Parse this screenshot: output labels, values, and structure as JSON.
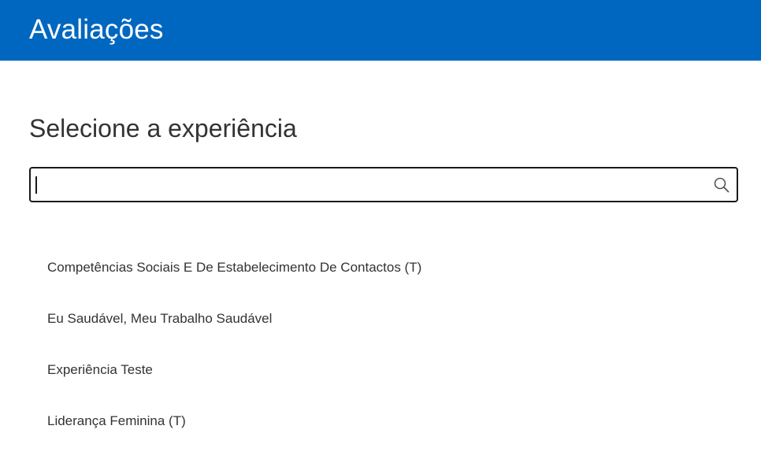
{
  "header": {
    "title": "Avaliações",
    "background_color": "#0067c0"
  },
  "main": {
    "heading": "Selecione a experiência",
    "search": {
      "value": "",
      "placeholder": "",
      "icon": "search-icon"
    },
    "experiences": [
      {
        "label": "Competências Sociais E De Estabelecimento De Contactos (T)"
      },
      {
        "label": "Eu Saudável, Meu Trabalho Saudável"
      },
      {
        "label": "Experiência Teste"
      },
      {
        "label": "Liderança Feminina (T)"
      }
    ]
  }
}
